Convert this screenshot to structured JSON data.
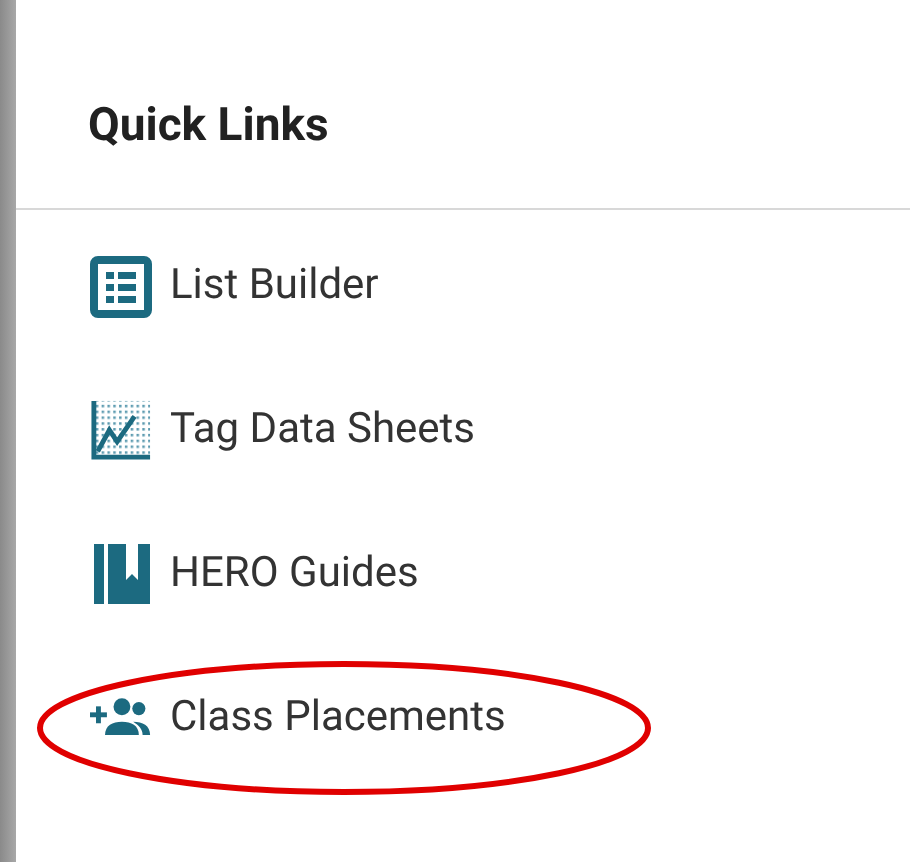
{
  "panel": {
    "title": "Quick Links"
  },
  "links": [
    {
      "label": "List Builder",
      "circled": false
    },
    {
      "label": "Tag Data Sheets",
      "circled": false
    },
    {
      "label": "HERO Guides",
      "circled": false
    },
    {
      "label": "Class Placements",
      "circled": true
    }
  ]
}
